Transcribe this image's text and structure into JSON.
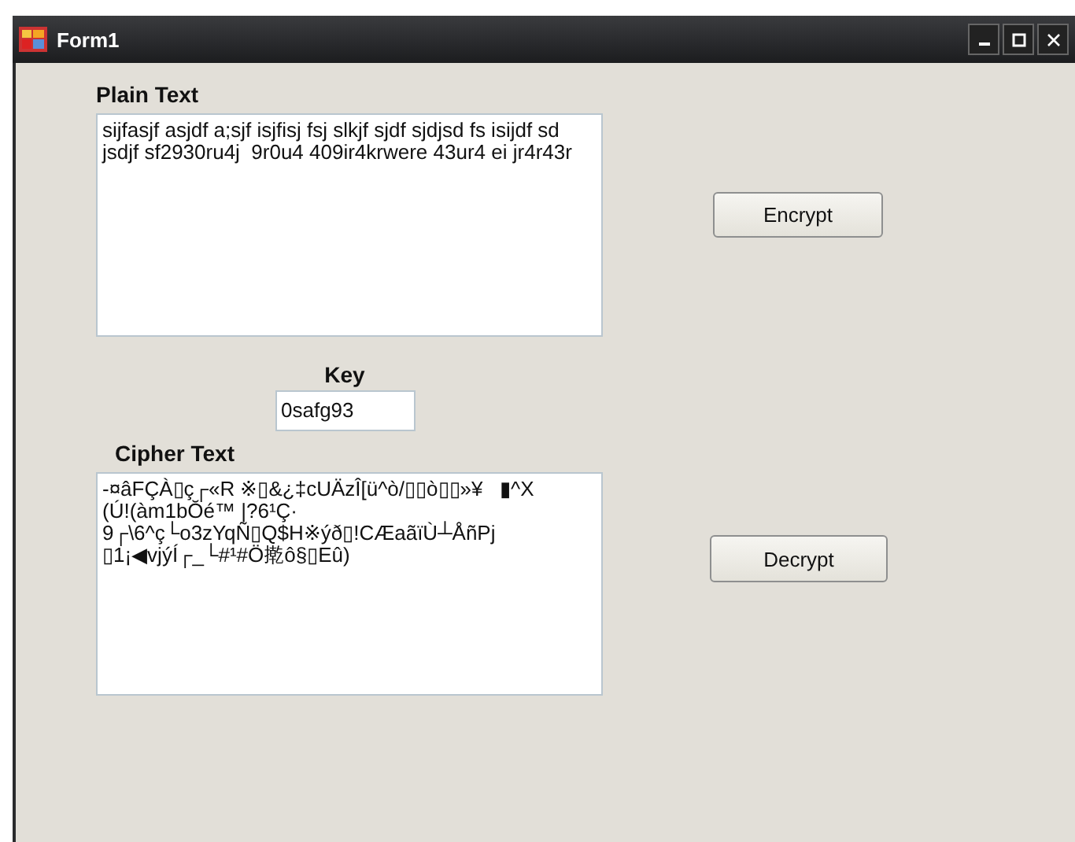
{
  "window": {
    "title": "Form1"
  },
  "plain_text": {
    "label": "Plain Text",
    "value": "sijfasjf asjdf a;sjf isjfisj fsj slkjf sjdf sjdjsd fs isijdf sd jsdjf sf2930ru4j  9r0u4 409ir4krwere 43ur4 ei jr4r43r"
  },
  "encrypt_button": "Encrypt",
  "key": {
    "label": "Key",
    "value": "0safg93"
  },
  "cipher_text": {
    "label": "Cipher Text",
    "lines": [
      "-¤âFÇÀ▯ç┌«R ※▯&¿‡cUÄzÎ[ü^ò/▯▯ò▯▯»¥   ▮^X",
      "(Ú!(àm1bŎé™ |?6¹Ç·",
      "9┌\\6^ç└o3zYqÑ▯Q$H※ýð▯!CÆaãïÙ┴ÅñPj",
      "▯1¡◀vjýÍ┌_└#¹#Ö㨴ô§▯Eû)"
    ]
  },
  "decrypt_button": "Decrypt"
}
